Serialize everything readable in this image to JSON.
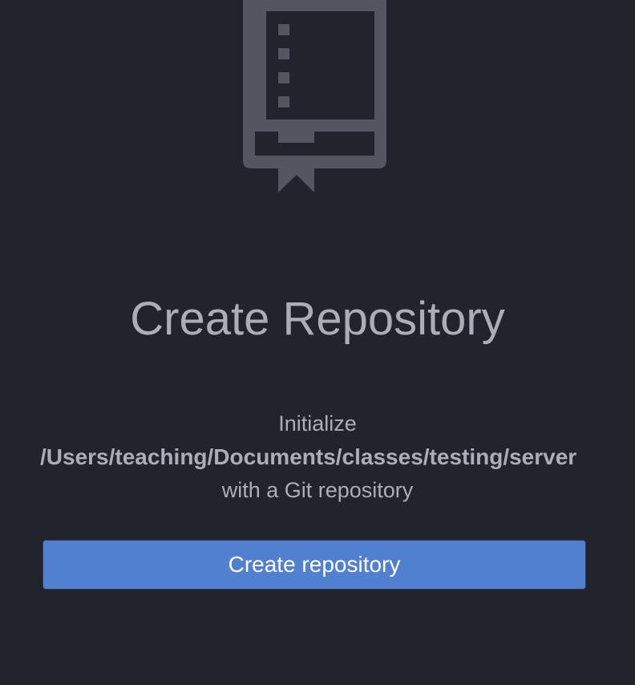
{
  "illustration": {
    "icon": "repo-book-icon",
    "color": "#535661"
  },
  "colors": {
    "background": "#21242c",
    "text": "#a9aeb7",
    "button": "#5280d0",
    "button_text": "#ffffff"
  },
  "title": "Create Repository",
  "intro": {
    "line1": "Initialize",
    "path": "/Users/teaching/Documents/classes/testing/server",
    "line3": "with a Git repository"
  },
  "actions": {
    "create_label": "Create repository"
  }
}
